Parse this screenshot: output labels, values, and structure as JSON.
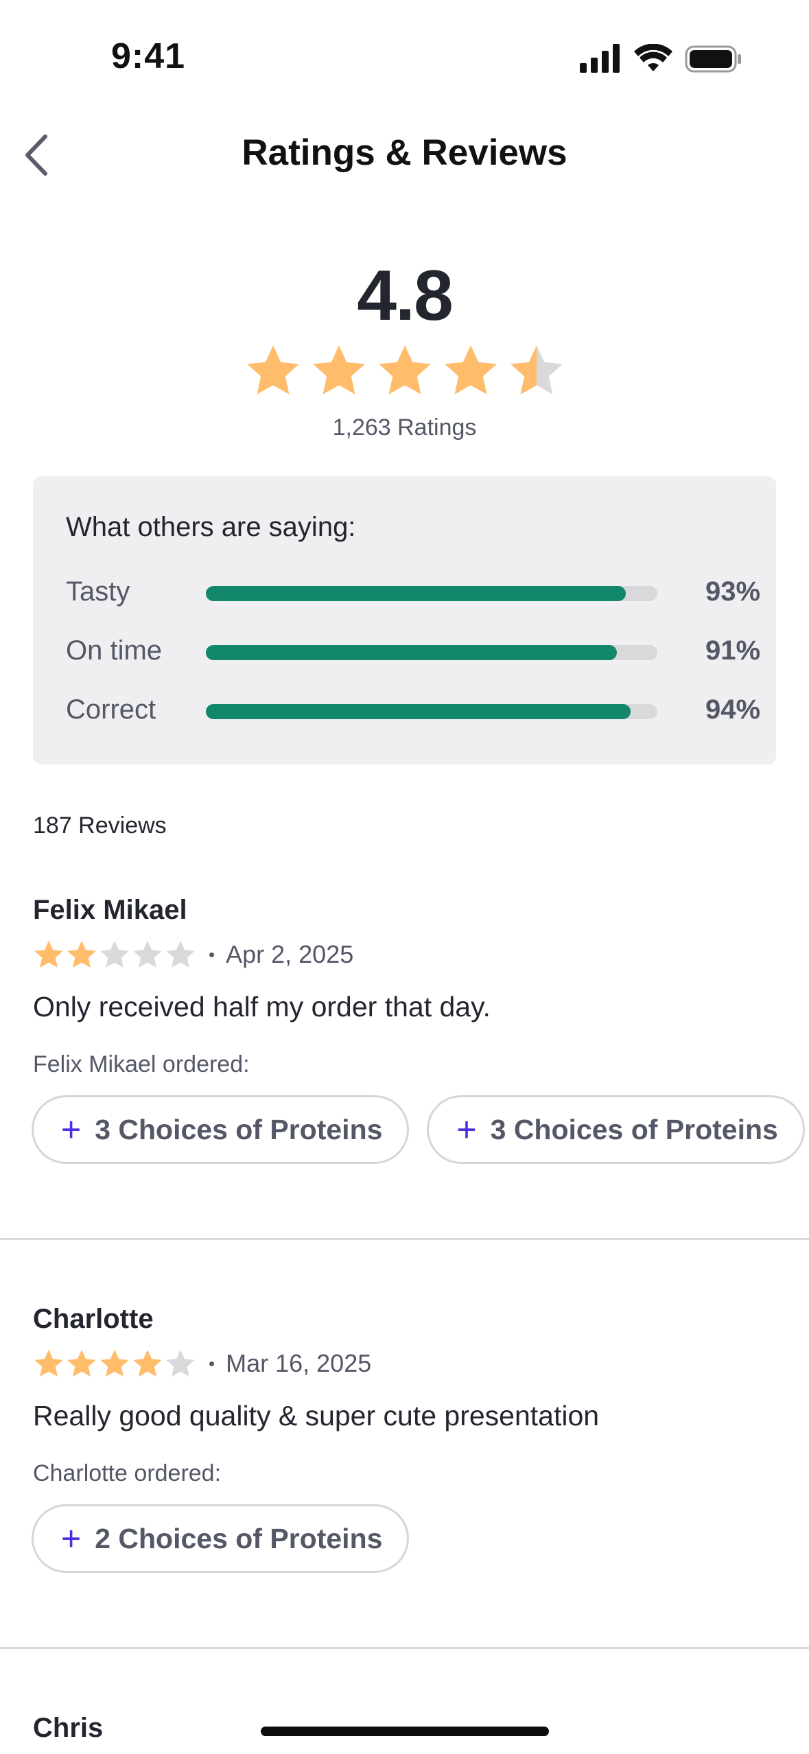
{
  "status_bar": {
    "time": "9:41"
  },
  "nav": {
    "title": "Ratings & Reviews",
    "back_icon": "chevron-left-icon"
  },
  "summary": {
    "score": "4.8",
    "stars_value": 4.5,
    "ratings_count": "1,263 Ratings"
  },
  "card": {
    "title": "What others are saying:",
    "metrics": [
      {
        "label": "Tasty",
        "percent": 93,
        "percent_text": "93%"
      },
      {
        "label": "On time",
        "percent": 91,
        "percent_text": "91%"
      },
      {
        "label": "Correct",
        "percent": 94,
        "percent_text": "94%"
      }
    ]
  },
  "reviews_count": "187 Reviews",
  "reviews": [
    {
      "name": "Felix Mikael",
      "stars": 2,
      "date": "Apr 2, 2025",
      "text": "Only received half my order that day.",
      "ordered": "Felix Mikael ordered:",
      "chips": [
        "3 Choices of Proteins",
        "3 Choices of Proteins"
      ]
    },
    {
      "name": "Charlotte",
      "stars": 4,
      "date": "Mar 16, 2025",
      "text": "Really good quality & super cute presentation",
      "ordered": "Charlotte ordered:",
      "chips": [
        "2 Choices of Proteins"
      ]
    },
    {
      "name": "Chris"
    }
  ],
  "colors": {
    "star_filled": "#FFBC6B",
    "star_empty": "#D9D9DC",
    "bar_fill": "#12876A",
    "accent_plus": "#4B2FE0"
  },
  "chip_plus": "+",
  "dot": "•"
}
